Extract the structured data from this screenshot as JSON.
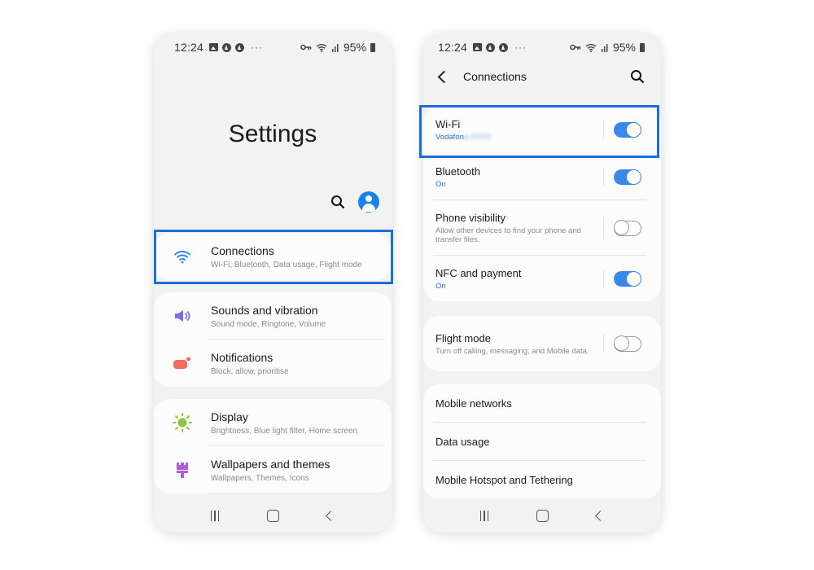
{
  "status_bar": {
    "time": "12:24",
    "battery": "95%",
    "left_icons": [
      "image-icon",
      "notification-a-icon",
      "notification-a-icon",
      "more-dots-icon"
    ],
    "right_icons": [
      "vpn-key-icon",
      "wifi-icon",
      "signal-icon",
      "battery-icon"
    ],
    "dots": "···"
  },
  "left_screen": {
    "title": "Settings",
    "actions": [
      "search-icon",
      "profile-avatar"
    ],
    "groups": [
      {
        "items": [
          {
            "title": "Connections",
            "subtitle": "Wi-Fi, Bluetooth, Data usage, Flight mode",
            "icon": "wifi-icon",
            "icon_color": "#3a8be6",
            "highlighted": true
          }
        ]
      },
      {
        "items": [
          {
            "title": "Sounds and vibration",
            "subtitle": "Sound mode, Ringtone, Volume",
            "icon": "speaker-icon",
            "icon_color": "#7b6fe0"
          },
          {
            "title": "Notifications",
            "subtitle": "Block, allow, prioritise",
            "icon": "notification-icon",
            "icon_color": "#ef6e5e"
          }
        ]
      },
      {
        "items": [
          {
            "title": "Display",
            "subtitle": "Brightness, Blue light filter, Home screen",
            "icon": "sun-icon",
            "icon_color": "#8cc63f"
          },
          {
            "title": "Wallpapers and themes",
            "subtitle": "Wallpapers, Themes, Icons",
            "icon": "paintbrush-icon",
            "icon_color": "#b05ed6"
          }
        ]
      }
    ]
  },
  "right_screen": {
    "title": "Connections",
    "toggles": [
      {
        "title": "Wi-Fi",
        "subtitle": "Vodafon",
        "subtitle_blurred": "e-XXXX",
        "state": "on",
        "highlighted": true
      },
      {
        "title": "Bluetooth",
        "subtitle": "On",
        "state": "on"
      },
      {
        "title": "Phone visibility",
        "subtitle": "Allow other devices to find your phone and transfer files.",
        "state": "off"
      },
      {
        "title": "NFC and payment",
        "subtitle": "On",
        "state": "on"
      },
      {
        "title": "Flight mode",
        "subtitle": "Turn off calling, messaging, and Mobile data.",
        "state": "off"
      }
    ],
    "links": [
      "Mobile networks",
      "Data usage",
      "Mobile Hotspot and Tethering"
    ]
  },
  "colors": {
    "highlight": "#1a6fe0",
    "toggle_on": "#3a88ec",
    "link_blue": "#1a73c9",
    "avatar": "#1a82ec"
  },
  "nav_bar": [
    "recent-apps-button",
    "home-button",
    "back-button"
  ]
}
